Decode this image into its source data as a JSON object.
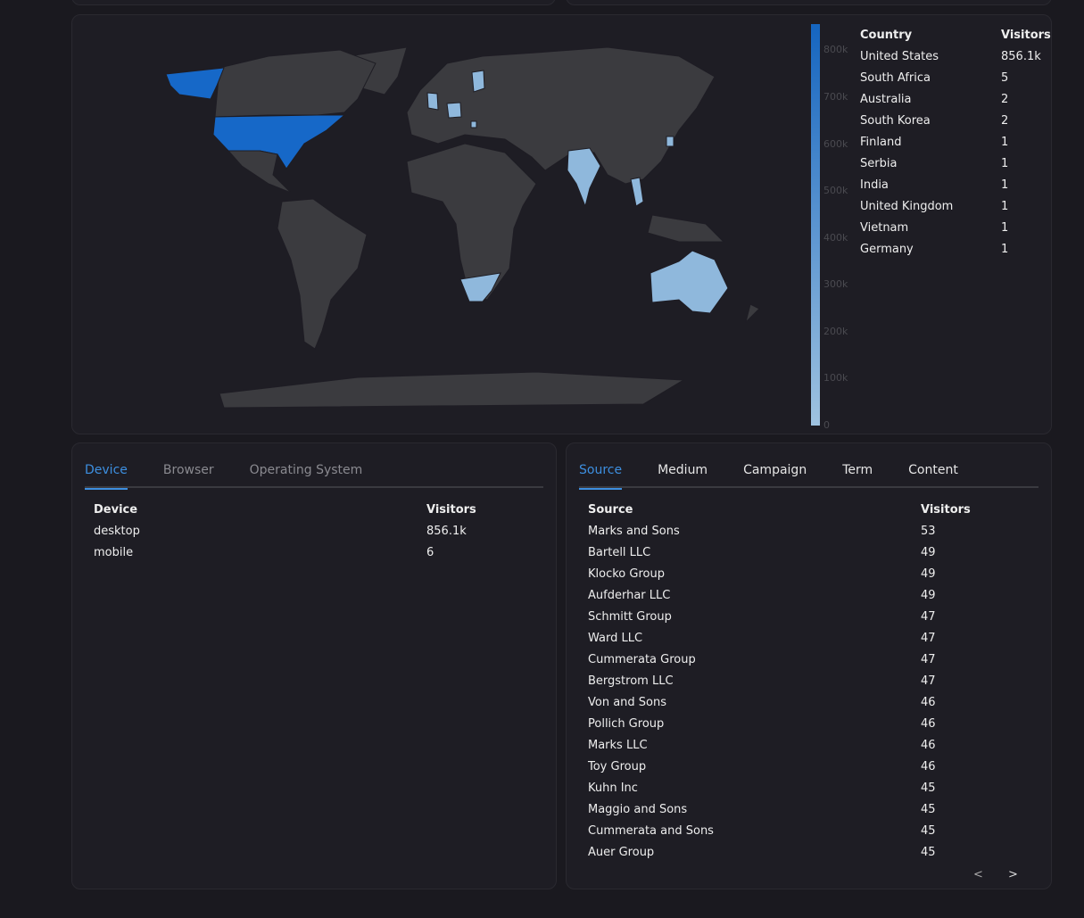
{
  "map": {
    "legend_ticks": [
      "800k",
      "700k",
      "600k",
      "500k",
      "400k",
      "300k",
      "200k",
      "100k",
      "0"
    ],
    "legend_max": 856100,
    "colors": {
      "high": "#1565c0",
      "low": "#9fc3e0",
      "no_data": "#3b3b3f"
    },
    "table": {
      "headers": {
        "country": "Country",
        "visitors": "Visitors"
      },
      "rows": [
        {
          "country": "United States",
          "visitors": "856.1k"
        },
        {
          "country": "South Africa",
          "visitors": "5"
        },
        {
          "country": "Australia",
          "visitors": "2"
        },
        {
          "country": "South Korea",
          "visitors": "2"
        },
        {
          "country": "Finland",
          "visitors": "1"
        },
        {
          "country": "Serbia",
          "visitors": "1"
        },
        {
          "country": "India",
          "visitors": "1"
        },
        {
          "country": "United Kingdom",
          "visitors": "1"
        },
        {
          "country": "Vietnam",
          "visitors": "1"
        },
        {
          "country": "Germany",
          "visitors": "1"
        }
      ]
    }
  },
  "devices": {
    "tabs": [
      "Device",
      "Browser",
      "Operating System"
    ],
    "headers": {
      "name": "Device",
      "visitors": "Visitors"
    },
    "rows": [
      {
        "name": "desktop",
        "visitors": "856.1k"
      },
      {
        "name": "mobile",
        "visitors": "6"
      }
    ]
  },
  "sources": {
    "tabs": [
      "Source",
      "Medium",
      "Campaign",
      "Term",
      "Content"
    ],
    "headers": {
      "name": "Source",
      "visitors": "Visitors"
    },
    "rows": [
      {
        "name": "Marks and Sons",
        "visitors": "53"
      },
      {
        "name": "Bartell LLC",
        "visitors": "49"
      },
      {
        "name": "Klocko Group",
        "visitors": "49"
      },
      {
        "name": "Aufderhar LLC",
        "visitors": "49"
      },
      {
        "name": "Schmitt Group",
        "visitors": "47"
      },
      {
        "name": "Ward LLC",
        "visitors": "47"
      },
      {
        "name": "Cummerata Group",
        "visitors": "47"
      },
      {
        "name": "Bergstrom LLC",
        "visitors": "47"
      },
      {
        "name": "Von and Sons",
        "visitors": "46"
      },
      {
        "name": "Pollich Group",
        "visitors": "46"
      },
      {
        "name": "Marks LLC",
        "visitors": "46"
      },
      {
        "name": "Toy Group",
        "visitors": "46"
      },
      {
        "name": "Kuhn Inc",
        "visitors": "45"
      },
      {
        "name": "Maggio and Sons",
        "visitors": "45"
      },
      {
        "name": "Cummerata and Sons",
        "visitors": "45"
      },
      {
        "name": "Auer Group",
        "visitors": "45"
      }
    ],
    "pager": {
      "prev": "<",
      "next": ">"
    }
  }
}
